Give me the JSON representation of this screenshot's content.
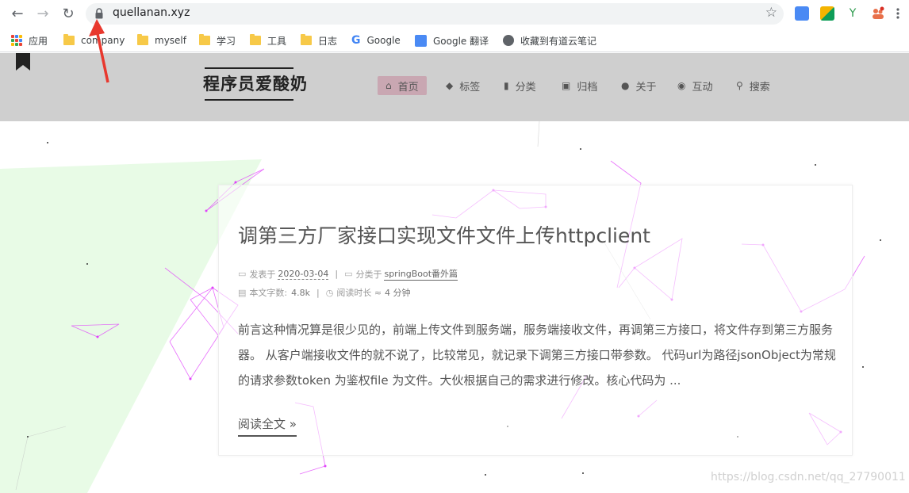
{
  "browser": {
    "url": "quellanan.xyz",
    "bookmarks": [
      {
        "label": "应用",
        "type": "apps"
      },
      {
        "label": "company",
        "type": "folder"
      },
      {
        "label": "myself",
        "type": "folder"
      },
      {
        "label": "学习",
        "type": "folder"
      },
      {
        "label": "工具",
        "type": "folder"
      },
      {
        "label": "日志",
        "type": "folder"
      },
      {
        "label": "Google",
        "type": "google"
      },
      {
        "label": "Google 翻译",
        "type": "translate"
      },
      {
        "label": "收藏到有道云笔记",
        "type": "globe"
      }
    ]
  },
  "site": {
    "brand": "程序员爱酸奶",
    "menu": [
      {
        "label": "首页",
        "icon": "home-icon",
        "glyph": "⌂",
        "active": true
      },
      {
        "label": "标签",
        "icon": "tag-icon",
        "glyph": "◆",
        "active": false
      },
      {
        "label": "分类",
        "icon": "bookmark-icon",
        "glyph": "▮",
        "active": false
      },
      {
        "label": "归档",
        "icon": "archive-icon",
        "glyph": "▣",
        "active": false
      },
      {
        "label": "关于",
        "icon": "user-icon",
        "glyph": "●",
        "active": false
      },
      {
        "label": "互动",
        "icon": "comments-icon",
        "glyph": "◉",
        "active": false
      },
      {
        "label": "搜索",
        "icon": "search-icon",
        "glyph": "⚲",
        "active": false
      }
    ]
  },
  "post": {
    "title": "调第三方厂家接口实现文件文件上传httpclient",
    "posted_label": "发表于",
    "posted_date": "2020-03-04",
    "category_label": "分类于",
    "category": "springBoot番外篇",
    "wordcount_label": "本文字数:",
    "wordcount": "4.8k",
    "readtime_label": "阅读时长 ≈",
    "readtime": "4 分钟",
    "excerpt": "前言这种情况算是很少见的，前端上传文件到服务端，服务端接收文件，再调第三方接口，将文件存到第三方服务器。 从客户端接收文件的就不说了，比较常见，就记录下调第三方接口带参数。 代码url为路径jsonObject为常规的请求参数token 为鉴权file 为文件。大伙根据自己的需求进行修改。核心代码为 ...",
    "read_more": "阅读全文 »"
  },
  "watermark": "https://blog.csdn.net/qq_27790011",
  "colors": {
    "accent": "#c9a7b2",
    "header_bg": "#cfcfcf",
    "network_line": "#e040fb",
    "green_band": "#e8fbe6",
    "arrow": "#e8382e"
  }
}
